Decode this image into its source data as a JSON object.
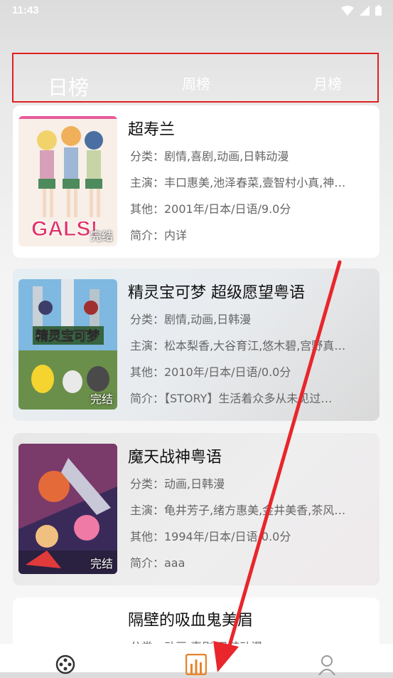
{
  "status_bar": {
    "time": "11:43"
  },
  "tabs": [
    {
      "label": "日榜",
      "active": true
    },
    {
      "label": "周榜",
      "active": false
    },
    {
      "label": "月榜",
      "active": false
    }
  ],
  "colors": {
    "tab_highlight_border": "#e02020",
    "annotation_arrow": "#e8262b"
  },
  "items": [
    {
      "title": "超寿兰",
      "category": "分类：剧情,喜剧,动画,日韩动漫",
      "cast": "主演：丰口惠美,池泽春菜,壹智村小真,神…",
      "other": "其他：2001年/日本/日语/9.0分",
      "intro": "简介：内详",
      "status": "完结",
      "poster_logo": "GALS!"
    },
    {
      "title": "精灵宝可梦 超级愿望粤语",
      "category": "分类：剧情,动画,日韩漫",
      "cast": "主演：松本梨香,大谷育江,悠木碧,宫野真…",
      "other": "其他：2010年/日本/日语/0.0分",
      "intro": "简介：【STORY】生活着众多从未见过…",
      "status": "完结",
      "poster_logo": "精灵宝可梦"
    },
    {
      "title": "魔天战神粤语",
      "category": "分类：动画,日韩漫",
      "cast": "主演：龟井芳子,绪方惠美,金井美香,茶风…",
      "other": "其他：1994年/日本/日语/0.0分",
      "intro": "简介：aaa",
      "status": "完结",
      "poster_logo": ""
    },
    {
      "title": "隔壁的吸血鬼美眉",
      "category": "分类：动画,喜剧,日韩动漫",
      "cast": "",
      "other": "",
      "intro": "",
      "status": "",
      "poster_logo": ""
    }
  ],
  "bottom_nav": [
    {
      "icon": "film-reel-icon"
    },
    {
      "icon": "chart-icon",
      "active": true
    },
    {
      "icon": "profile-icon"
    }
  ]
}
